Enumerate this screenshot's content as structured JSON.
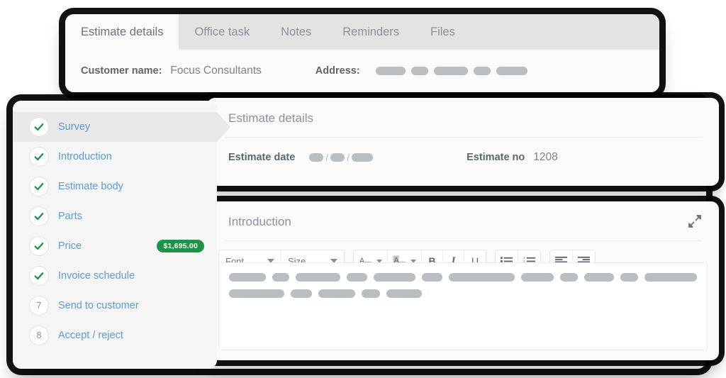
{
  "top_card": {
    "tabs": [
      {
        "label": "Estimate details",
        "active": true
      },
      {
        "label": "Office task",
        "active": false
      },
      {
        "label": "Notes",
        "active": false
      },
      {
        "label": "Reminders",
        "active": false
      },
      {
        "label": "Files",
        "active": false
      }
    ],
    "customer_name_label": "Customer name:",
    "customer_name_value": "Focus Consultants",
    "address_label": "Address:",
    "address_redacted_bars": [
      42,
      24,
      48,
      24,
      44
    ]
  },
  "sidebar": {
    "items": [
      {
        "label": "Survey",
        "state": "done",
        "marker": "check",
        "active": true,
        "badge": null
      },
      {
        "label": "Introduction",
        "state": "done",
        "marker": "check",
        "active": false,
        "badge": null
      },
      {
        "label": "Estimate body",
        "state": "done",
        "marker": "check",
        "active": false,
        "badge": null
      },
      {
        "label": "Parts",
        "state": "done",
        "marker": "check",
        "active": false,
        "badge": null
      },
      {
        "label": "Price",
        "state": "done",
        "marker": "check",
        "active": false,
        "badge": "$1,695.00"
      },
      {
        "label": "Invoice schedule",
        "state": "done",
        "marker": "check",
        "active": false,
        "badge": null
      },
      {
        "label": "Send to customer",
        "state": "todo",
        "marker": "7",
        "active": false,
        "badge": null
      },
      {
        "label": "Accept / reject",
        "state": "todo",
        "marker": "8",
        "active": false,
        "badge": null
      }
    ]
  },
  "details_panel": {
    "title": "Estimate details",
    "date_label": "Estimate date",
    "date_redacted_bars": [
      20,
      20,
      30
    ],
    "date_separator": "/",
    "number_label": "Estimate no",
    "number_value": "1208"
  },
  "editor_panel": {
    "title": "Introduction",
    "expand_icon": "expand-diagonal-icon",
    "toolbar": {
      "font_select": "Font",
      "size_select": "Size",
      "text_color_icon": "text-color-icon",
      "background_color_icon": "background-color-icon",
      "bold_label": "B",
      "italic_label": "I",
      "underline_label": "U",
      "bulleted_list_icon": "bulleted-list-icon",
      "numbered_list_icon": "numbered-list-icon",
      "align_left_icon": "align-left-icon",
      "align_right_icon": "align-right-icon"
    },
    "content_redacted_lines": [
      [
        54,
        26,
        66,
        30,
        62,
        30,
        98,
        48,
        26,
        44,
        26,
        78
      ],
      [
        78,
        30,
        52,
        26,
        50
      ]
    ]
  },
  "colors": {
    "accent_link": "#5b9bd5",
    "badge_green": "#1e9348",
    "check_green": "#1e9348",
    "redaction_gray": "#b9bec3",
    "tabbar_gray": "#e3e3e3",
    "card_bg": "#fafafa"
  }
}
